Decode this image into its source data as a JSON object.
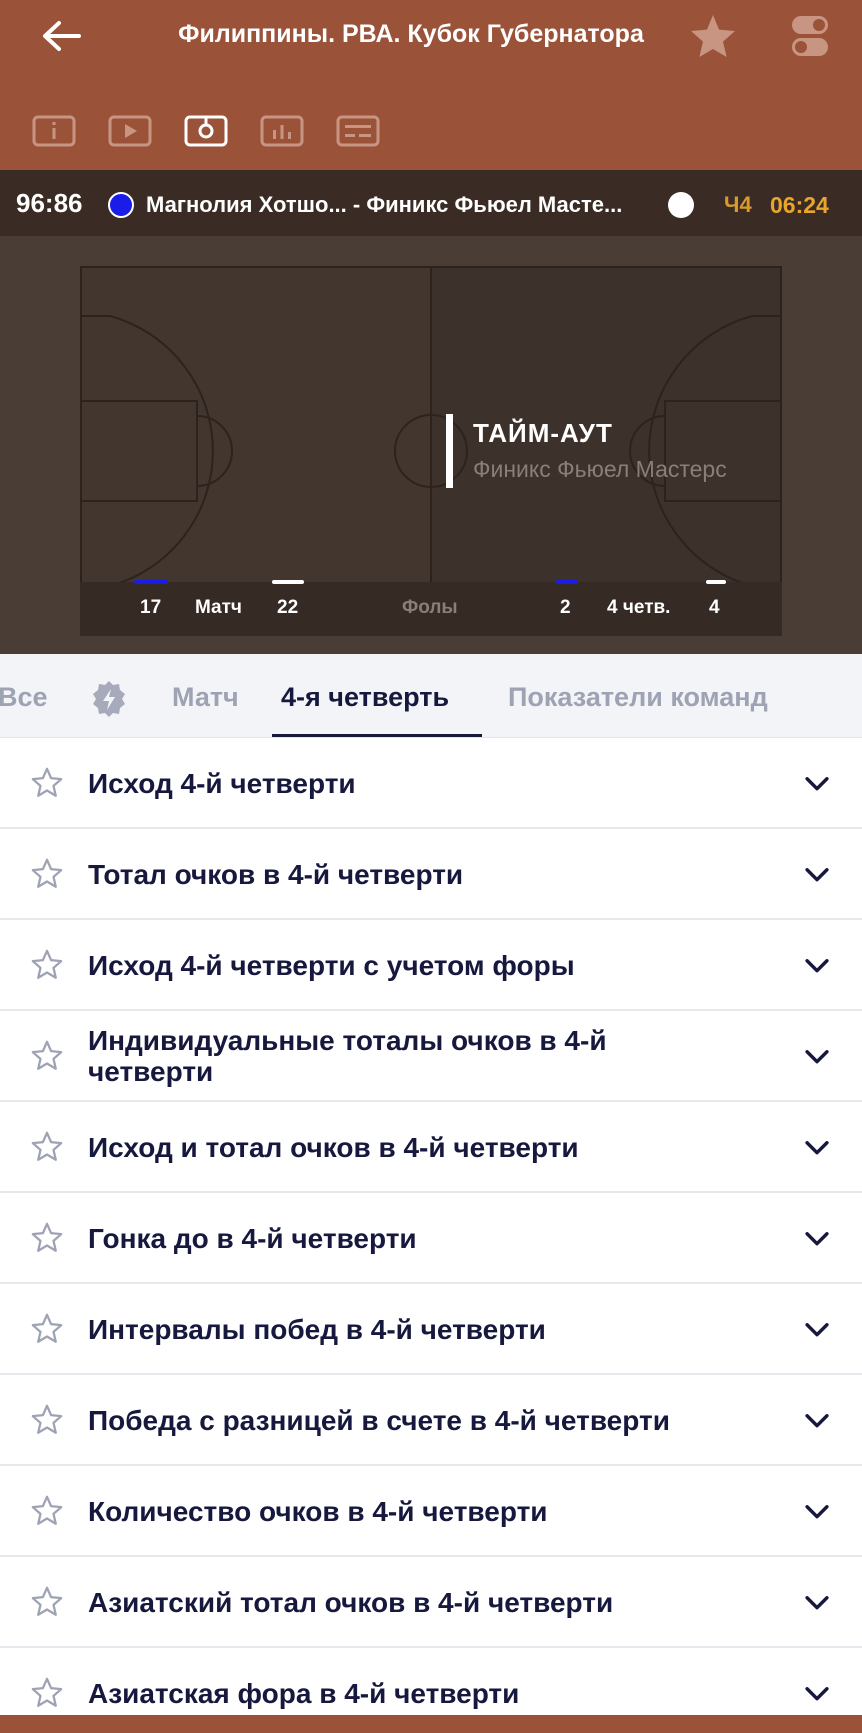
{
  "header": {
    "title": "Филиппины. РВА. Кубок Губернатора",
    "icons": [
      "back-arrow-icon",
      "star-icon",
      "toggle-settings-icon"
    ],
    "view_icons": [
      "info-icon",
      "video-icon",
      "field-icon",
      "stats-icon",
      "scoreboard-icon"
    ],
    "active_view": "field-icon",
    "color": "#9a5238"
  },
  "scorebar": {
    "score": "96:86",
    "teams": "Магнолия Хотшо... - Финикс Фьюел Масте...",
    "team1_color": "#1a1de8",
    "team2_color": "#ffffff",
    "quarter": "Ч4",
    "clock": "06:24"
  },
  "court": {
    "event_title": "ТАЙМ-АУТ",
    "event_team": "Финикс Фьюел Мастерс",
    "stats": {
      "team1_match": "17",
      "match_label": "Матч",
      "team2_match": "22",
      "fouls_label": "Фолы",
      "team1_quarter": "2",
      "quarter_label": "4 четв.",
      "team2_quarter": "4"
    }
  },
  "tabs": {
    "items": [
      "Все",
      "Матч",
      "4-я четверть",
      "Показатели команд"
    ],
    "active": "4-я четверть"
  },
  "markets": [
    "Исход 4-й четверти",
    "Тотал очков в 4-й четверти",
    "Исход 4-й четверти с учетом форы",
    "Индивидуальные тоталы очков в 4-й четверти",
    "Исход и тотал очков в 4-й четверти",
    "Гонка до в 4-й четверти",
    "Интервалы побед в 4-й четверти",
    "Победа с разницей в счете в 4-й четверти",
    "Количество очков в 4-й четверти",
    "Азиатский тотал очков в 4-й четверти",
    "Азиатская фора в 4-й четверти"
  ]
}
